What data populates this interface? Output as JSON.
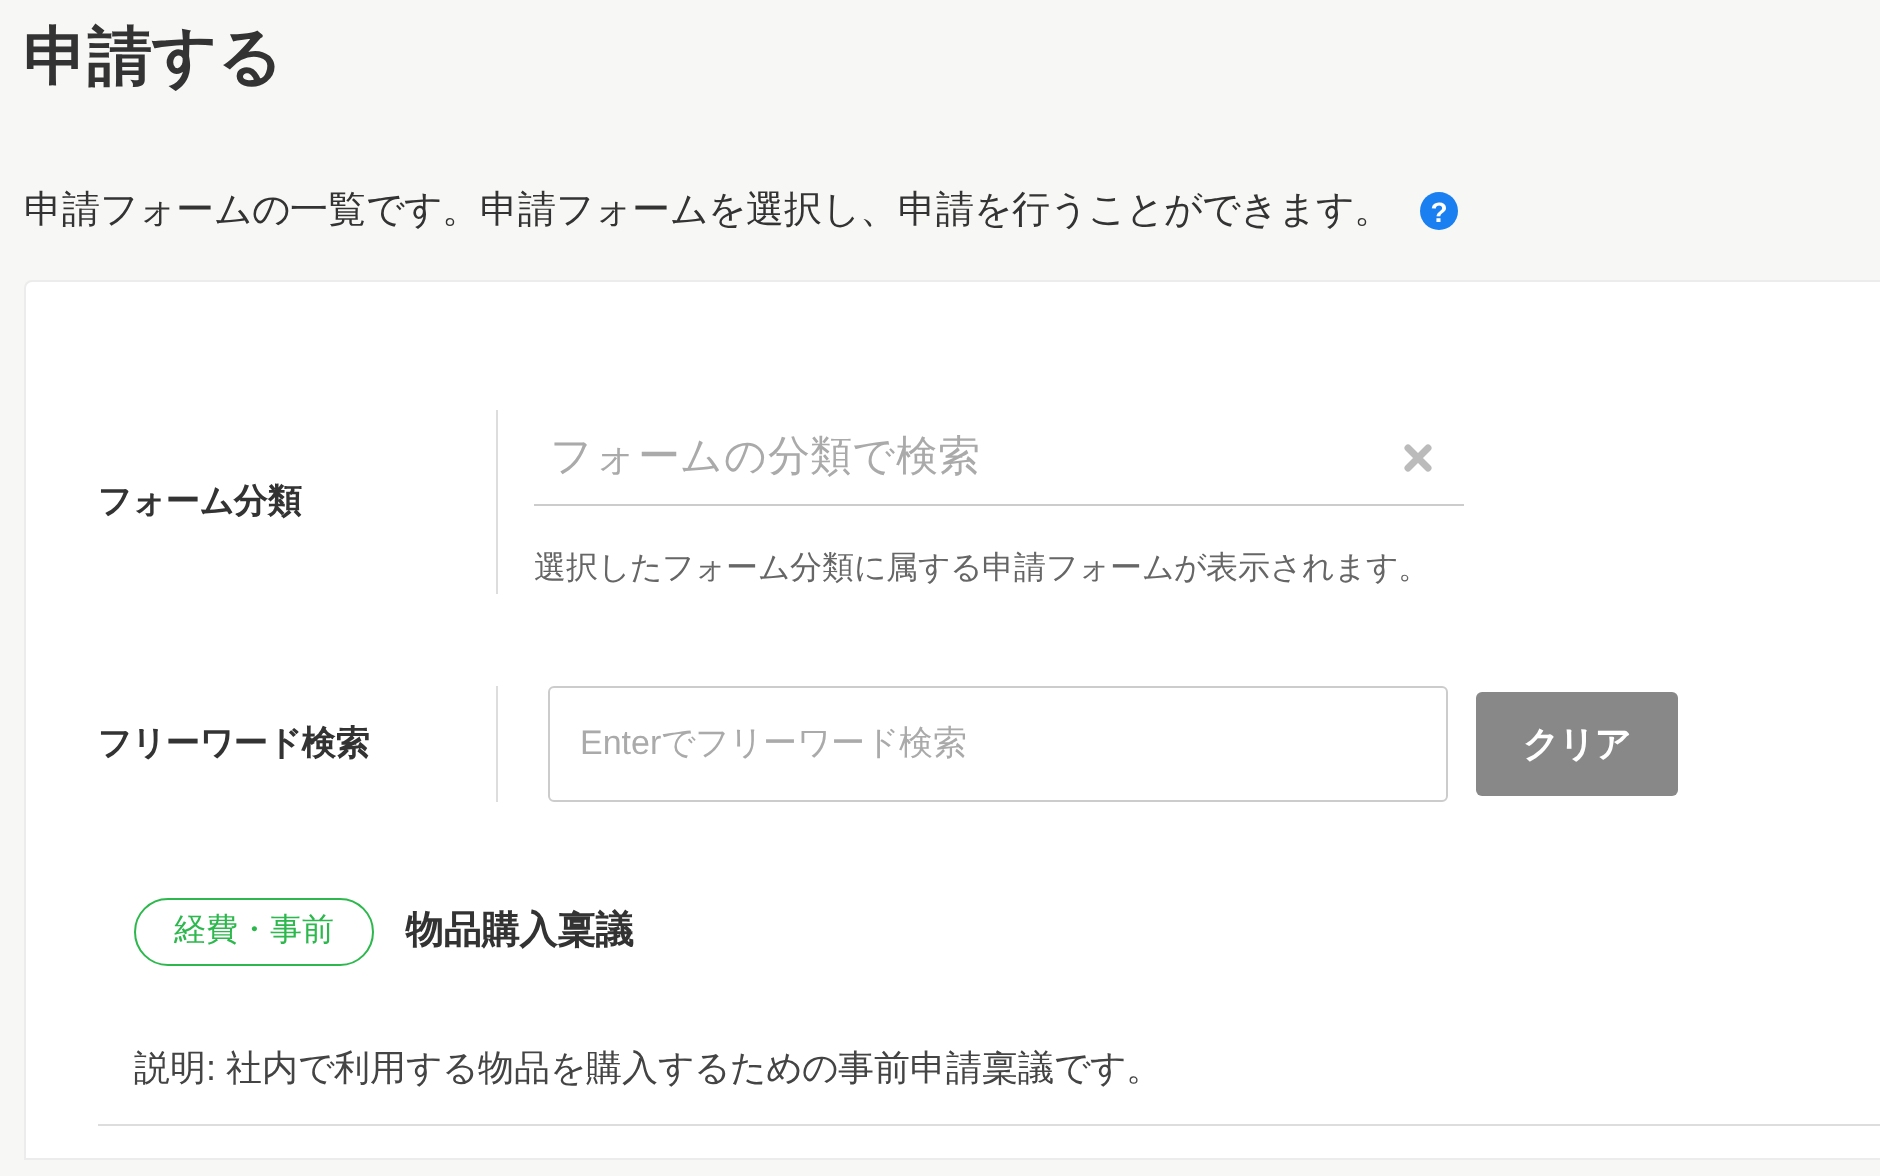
{
  "page": {
    "title": "申請する",
    "description": "申請フォームの一覧です。申請フォームを選択し、申請を行うことができます。",
    "help_mark": "?"
  },
  "filters": [
    {
      "kind": "select",
      "label": "フォーム分類",
      "placeholder": "フォームの分類で検索",
      "hint": "選択したフォーム分類に属する申請フォームが表示されます。"
    },
    {
      "kind": "text",
      "label": "フリーワード検索",
      "placeholder": "Enterでフリーワード検索",
      "button": "クリア"
    }
  ],
  "forms": [
    {
      "category": "経費・事前",
      "color": "#2db84d",
      "title": "物品購入稟議",
      "description": "説明: 社内で利用する物品を購入するための事前申請稟議です。"
    }
  ]
}
